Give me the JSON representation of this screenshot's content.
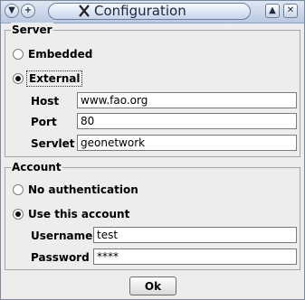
{
  "window": {
    "title": "Configuration",
    "controls": {
      "menu_icon": "chevron-down-icon",
      "add_icon": "plus-icon",
      "app_icon": "x-logo-icon",
      "maximize_icon": "maximize-icon",
      "close_icon": "close-icon"
    }
  },
  "server": {
    "group_title": "Server",
    "options": [
      {
        "label": "Embedded",
        "selected": false
      },
      {
        "label": "External",
        "selected": true
      }
    ],
    "fields": {
      "host": {
        "label": "Host",
        "value": "www.fao.org"
      },
      "port": {
        "label": "Port",
        "value": "80"
      },
      "servlet": {
        "label": "Servlet",
        "value": "geonetwork"
      }
    }
  },
  "account": {
    "group_title": "Account",
    "options": [
      {
        "label": "No authentication",
        "selected": false
      },
      {
        "label": "Use this account",
        "selected": true
      }
    ],
    "fields": {
      "username": {
        "label": "Username",
        "value": "test"
      },
      "password": {
        "label": "Password",
        "value": "****"
      }
    }
  },
  "actions": {
    "ok_label": "Ok"
  }
}
